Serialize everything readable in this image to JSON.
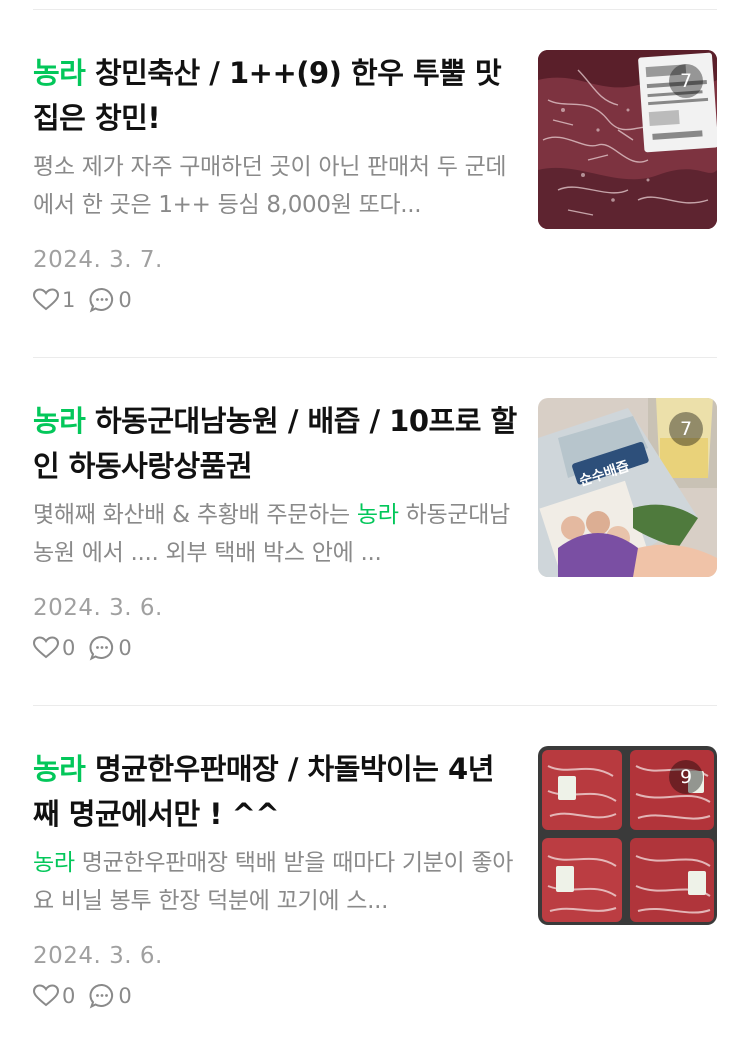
{
  "posts": [
    {
      "keyword": "농라",
      "title_rest": " 창민축산 / 1++(9) 한우 투뿔 맛집은 창민!",
      "excerpt_keyword": "",
      "excerpt": "평소 제가 자주 구매하던 곳이 아닌 판매처 두 군데에서 한 곳은 1++ 등심 8,000원 또다...",
      "date": "2024. 3. 7.",
      "likes": "1",
      "comments": "0",
      "photo_count": "7",
      "thumb_desc": "marbled raw beef"
    },
    {
      "keyword": "농라",
      "title_rest": " 하동군대남농원 / 배즙 / 10프로 할인 하동사랑상품권",
      "excerpt_keyword": "",
      "excerpt_prefix": "몇해째 화산배 & 추황배 주문하는 ",
      "excerpt_mid_keyword": "농라",
      "excerpt": " 하동군대남농원 에서 .... 외부 택배 박스 안에 ...",
      "date": "2024. 3. 6.",
      "likes": "0",
      "comments": "0",
      "photo_count": "7",
      "thumb_desc": "pear juice pouch"
    },
    {
      "keyword": "농라",
      "title_rest": " 명균한우판매장 / 차돌박이는 4년째 명균에서만 ! ^^",
      "excerpt_keyword": "농라",
      "excerpt": " 명균한우판매장 택배 받을 때마다 기분이 좋아요 비닐 봉투 한장 덕분에 꼬기에 스...",
      "date": "2024. 3. 6.",
      "likes": "0",
      "comments": "0",
      "photo_count": "9",
      "thumb_desc": "packaged brisket"
    }
  ],
  "colors": {
    "keyword": "#03c75a",
    "excerpt": "#8a8a8a",
    "date": "#a0a0a0"
  }
}
